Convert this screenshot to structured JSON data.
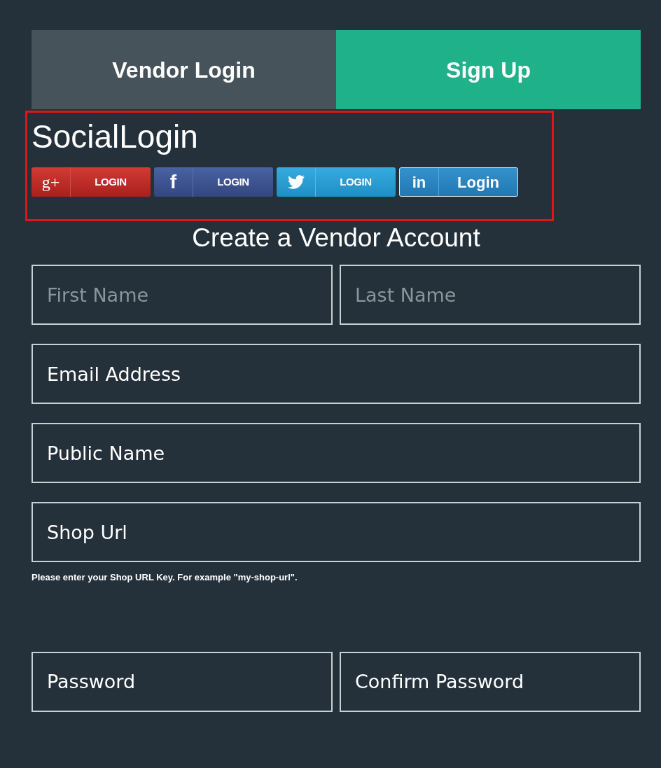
{
  "tabs": [
    {
      "label": "Vendor Login",
      "selected": false
    },
    {
      "label": "Sign Up",
      "selected": true
    }
  ],
  "social_login": {
    "title": "SocialLogin",
    "highlighted": true,
    "buttons": [
      {
        "kind": "google",
        "glyph": "g+",
        "label": "LOGIN"
      },
      {
        "kind": "facebook",
        "glyph": "f",
        "label": "LOGIN"
      },
      {
        "kind": "twitter",
        "label": "LOGIN"
      },
      {
        "kind": "linkedin",
        "glyph": "in",
        "label": "Login"
      }
    ]
  },
  "form": {
    "title": "Create a Vendor Account",
    "rows": [
      {
        "fields": [
          {
            "placeholder": "First Name"
          },
          {
            "placeholder": "Last Name"
          }
        ]
      },
      {
        "fields": [
          {
            "value": "Email Address"
          }
        ]
      },
      {
        "fields": [
          {
            "value": "Public Name"
          }
        ]
      },
      {
        "fields": [
          {
            "value": "Shop Url"
          }
        ],
        "hint": "Please enter your Shop URL Key. For example \"my-shop-url\"."
      },
      {
        "fields": [
          {
            "value": "Password"
          },
          {
            "value": "Confirm Password"
          }
        ]
      }
    ]
  }
}
